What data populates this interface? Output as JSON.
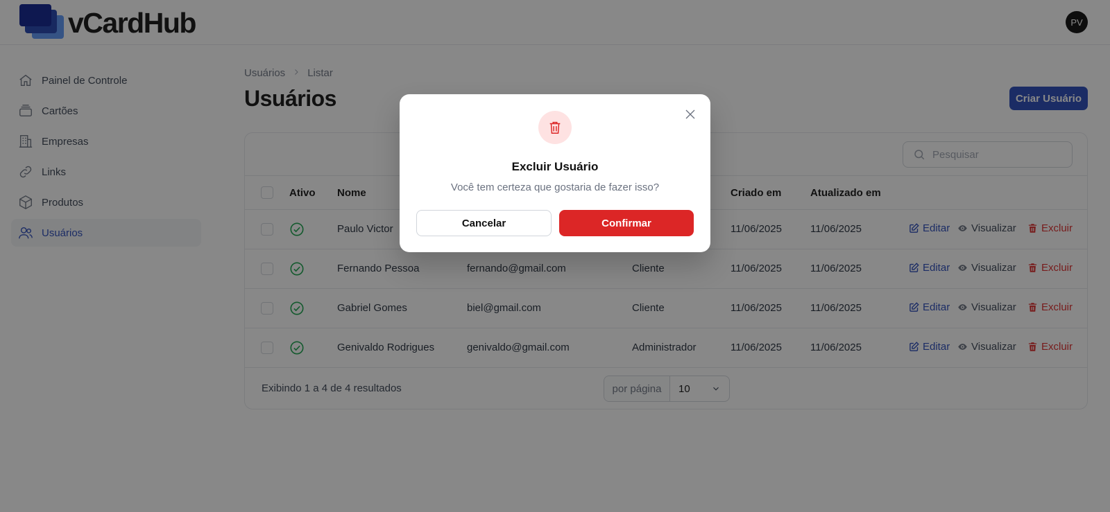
{
  "app": {
    "brand": "vCardHub",
    "avatar_initials": "PV"
  },
  "colors": {
    "accent": "#2546b8",
    "danger": "#dc2626",
    "success": "#16a34a",
    "logo_dark": "#0b1f8f",
    "logo_mid": "#1e40af",
    "logo_light": "#3b82f6"
  },
  "sidebar": {
    "items": [
      {
        "label": "Painel de Controle",
        "icon": "home-icon",
        "active": false
      },
      {
        "label": "Cartões",
        "icon": "cards-icon",
        "active": false
      },
      {
        "label": "Empresas",
        "icon": "building-icon",
        "active": false
      },
      {
        "label": "Links",
        "icon": "link-icon",
        "active": false
      },
      {
        "label": "Produtos",
        "icon": "cube-icon",
        "active": false
      },
      {
        "label": "Usuários",
        "icon": "users-icon",
        "active": true
      }
    ]
  },
  "breadcrumb": {
    "items": [
      "Usuários",
      "Listar"
    ]
  },
  "page": {
    "title": "Usuários",
    "create_button": "Criar Usuário"
  },
  "search": {
    "placeholder": "Pesquisar",
    "value": ""
  },
  "table": {
    "columns": [
      "Ativo",
      "Nome",
      "Criado em",
      "Atualizado em"
    ],
    "rows": [
      {
        "active": true,
        "name": "Paulo Victor",
        "email": "",
        "role": "",
        "created": "11/06/2025",
        "updated": "11/06/2025"
      },
      {
        "active": true,
        "name": "Fernando Pessoa",
        "email": "fernando@gmail.com",
        "role": "Cliente",
        "created": "11/06/2025",
        "updated": "11/06/2025"
      },
      {
        "active": true,
        "name": "Gabriel Gomes",
        "email": "biel@gmail.com",
        "role": "Cliente",
        "created": "11/06/2025",
        "updated": "11/06/2025"
      },
      {
        "active": true,
        "name": "Genivaldo Rodrigues",
        "email": "genivaldo@gmail.com",
        "role": "Administrador",
        "created": "11/06/2025",
        "updated": "11/06/2025"
      }
    ],
    "actions": {
      "edit": "Editar",
      "view": "Visualizar",
      "delete": "Excluir"
    }
  },
  "footer": {
    "summary": "Exibindo 1 a 4 de 4 resultados",
    "per_page_label": "por página",
    "per_page_value": "10"
  },
  "modal": {
    "icon": "trash-icon",
    "title": "Excluir Usuário",
    "description": "Você tem certeza que gostaria de fazer isso?",
    "cancel": "Cancelar",
    "confirm": "Confirmar"
  }
}
